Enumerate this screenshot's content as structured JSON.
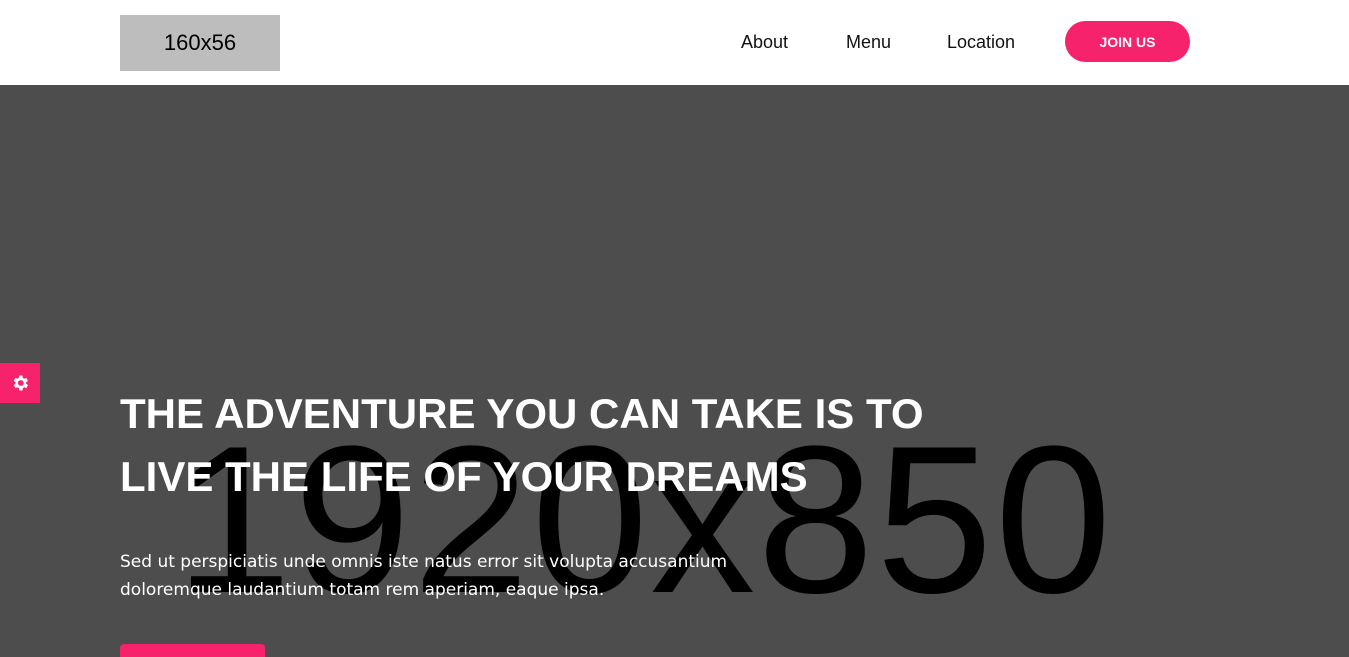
{
  "header": {
    "logo_text": "160x56",
    "nav": [
      {
        "label": "About"
      },
      {
        "label": "Menu"
      },
      {
        "label": "Location"
      }
    ],
    "join_label": "JOIN US"
  },
  "hero": {
    "placeholder_text": "1920x850",
    "title_line1": "THE ADVENTURE YOU CAN TAKE IS TO",
    "title_line2": "LIVE THE LIFE OF YOUR DREAMS",
    "paragraph": "Sed ut perspiciatis unde omnis iste natus error sit volupta accusantium doloremque laudantium totam rem aperiam, eaque ipsa."
  },
  "settings": {
    "icon": "gear-icon"
  },
  "colors": {
    "accent": "#f7226c",
    "hero_bg": "#4d4d4d",
    "logo_bg": "#bdbdbd",
    "header_bg": "#ffffff"
  }
}
